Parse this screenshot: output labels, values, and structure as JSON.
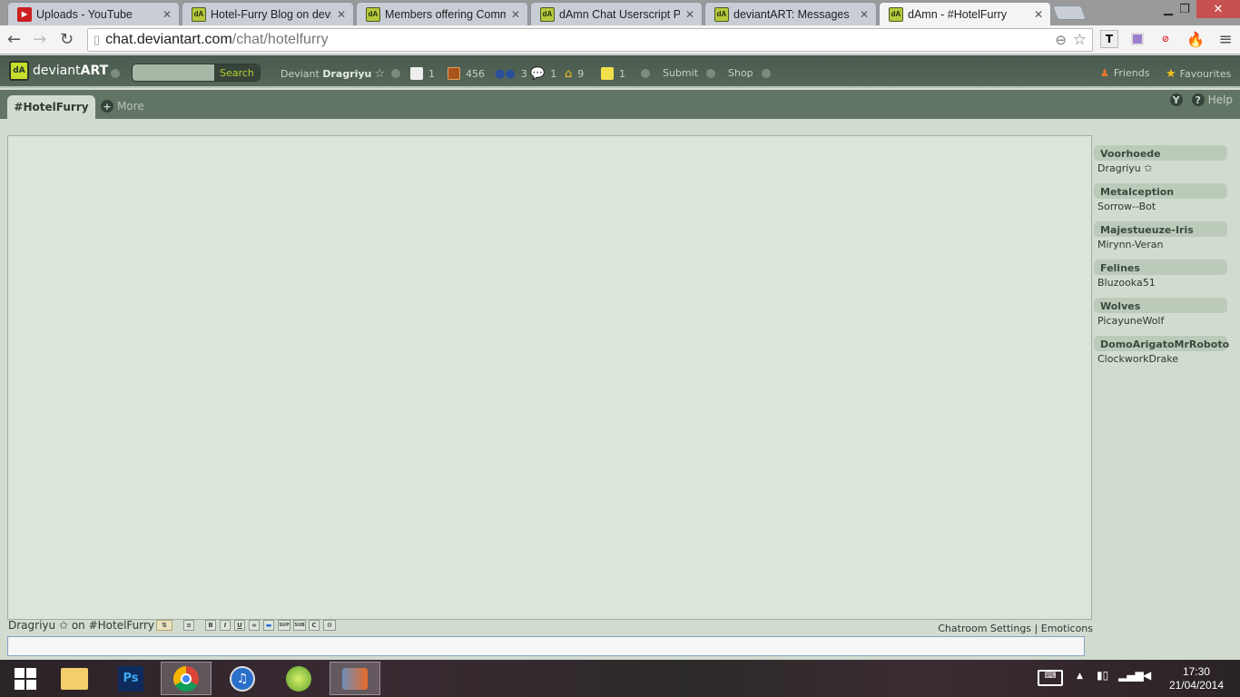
{
  "browser": {
    "tabs": [
      {
        "title": "Uploads - YouTube",
        "favicon": "youtube-icon",
        "active": false
      },
      {
        "title": "Hotel-Furry Blog on devia",
        "favicon": "deviantart-icon",
        "active": false
      },
      {
        "title": "Members offering Commi",
        "favicon": "deviantart-icon",
        "active": false
      },
      {
        "title": "dAmn Chat Userscript Pro",
        "favicon": "deviantart-icon",
        "active": false
      },
      {
        "title": "deviantART: Messages",
        "favicon": "deviantart-icon",
        "active": false
      },
      {
        "title": "dAmn - #HotelFurry",
        "favicon": "deviantart-icon",
        "active": true
      }
    ],
    "url_host": "chat.deviantart.com",
    "url_path": "/chat/hotelfurry",
    "extensions": [
      "zoom-icon",
      "bookmark-star-icon",
      "t-extension-icon",
      "purple-extension-icon",
      "adblock-icon",
      "hola-icon",
      "menu-icon"
    ]
  },
  "header": {
    "logo_text_light": "deviant",
    "logo_text_bold": "ART",
    "search_button": "Search",
    "search_placeholder": "",
    "user_prefix": "Deviant",
    "username": "Dragriyu",
    "notifications": [
      {
        "icon": "notice-icon",
        "count": "1"
      },
      {
        "icon": "deviations-icon",
        "count": "456"
      },
      {
        "icon": "watch-icon",
        "count": "3"
      },
      {
        "icon": "comments-icon",
        "count": "1"
      },
      {
        "icon": "home-icon",
        "count": "9"
      },
      {
        "icon": "notes-icon",
        "count": "1"
      }
    ],
    "submit": "Submit",
    "shop": "Shop",
    "friends": "Friends",
    "favourites": "Favourites"
  },
  "room": {
    "tab_label": "#HotelFurry",
    "more_label": "More",
    "help_label": "Help"
  },
  "members": [
    {
      "group": "Voorhoede",
      "users": [
        "Dragriyu"
      ],
      "starred": true
    },
    {
      "group": "Metalception",
      "users": [
        "Sorrow--Bot"
      ],
      "starred": false
    },
    {
      "group": "Majestueuze-Iris",
      "users": [
        "Mirynn-Veran"
      ],
      "starred": false
    },
    {
      "group": "Felines",
      "users": [
        "Bluzooka51"
      ],
      "starred": false
    },
    {
      "group": "Wolves",
      "users": [
        "PicayuneWolf"
      ],
      "starred": false
    },
    {
      "group": "DomoArigatoMrRoboto",
      "users": [
        "ClockworkDrake"
      ],
      "starred": false
    }
  ],
  "input": {
    "whoami": "Dragriyu",
    "on_text": "on #HotelFurry",
    "format_buttons": [
      "B",
      "I",
      "U",
      "∞",
      "▬",
      "SUP",
      "SUB",
      "C",
      "⚙"
    ],
    "chatroom_settings": "Chatroom Settings",
    "separator": "|",
    "emoticons": "Emoticons",
    "message_value": ""
  },
  "taskbar": {
    "apps": [
      "windows-start-icon",
      "file-explorer-icon",
      "photoshop-icon",
      "chrome-icon",
      "itunes-icon",
      "paint-tool-icon",
      "movie-maker-icon"
    ],
    "time": "17:30",
    "date": "21/04/2014"
  }
}
